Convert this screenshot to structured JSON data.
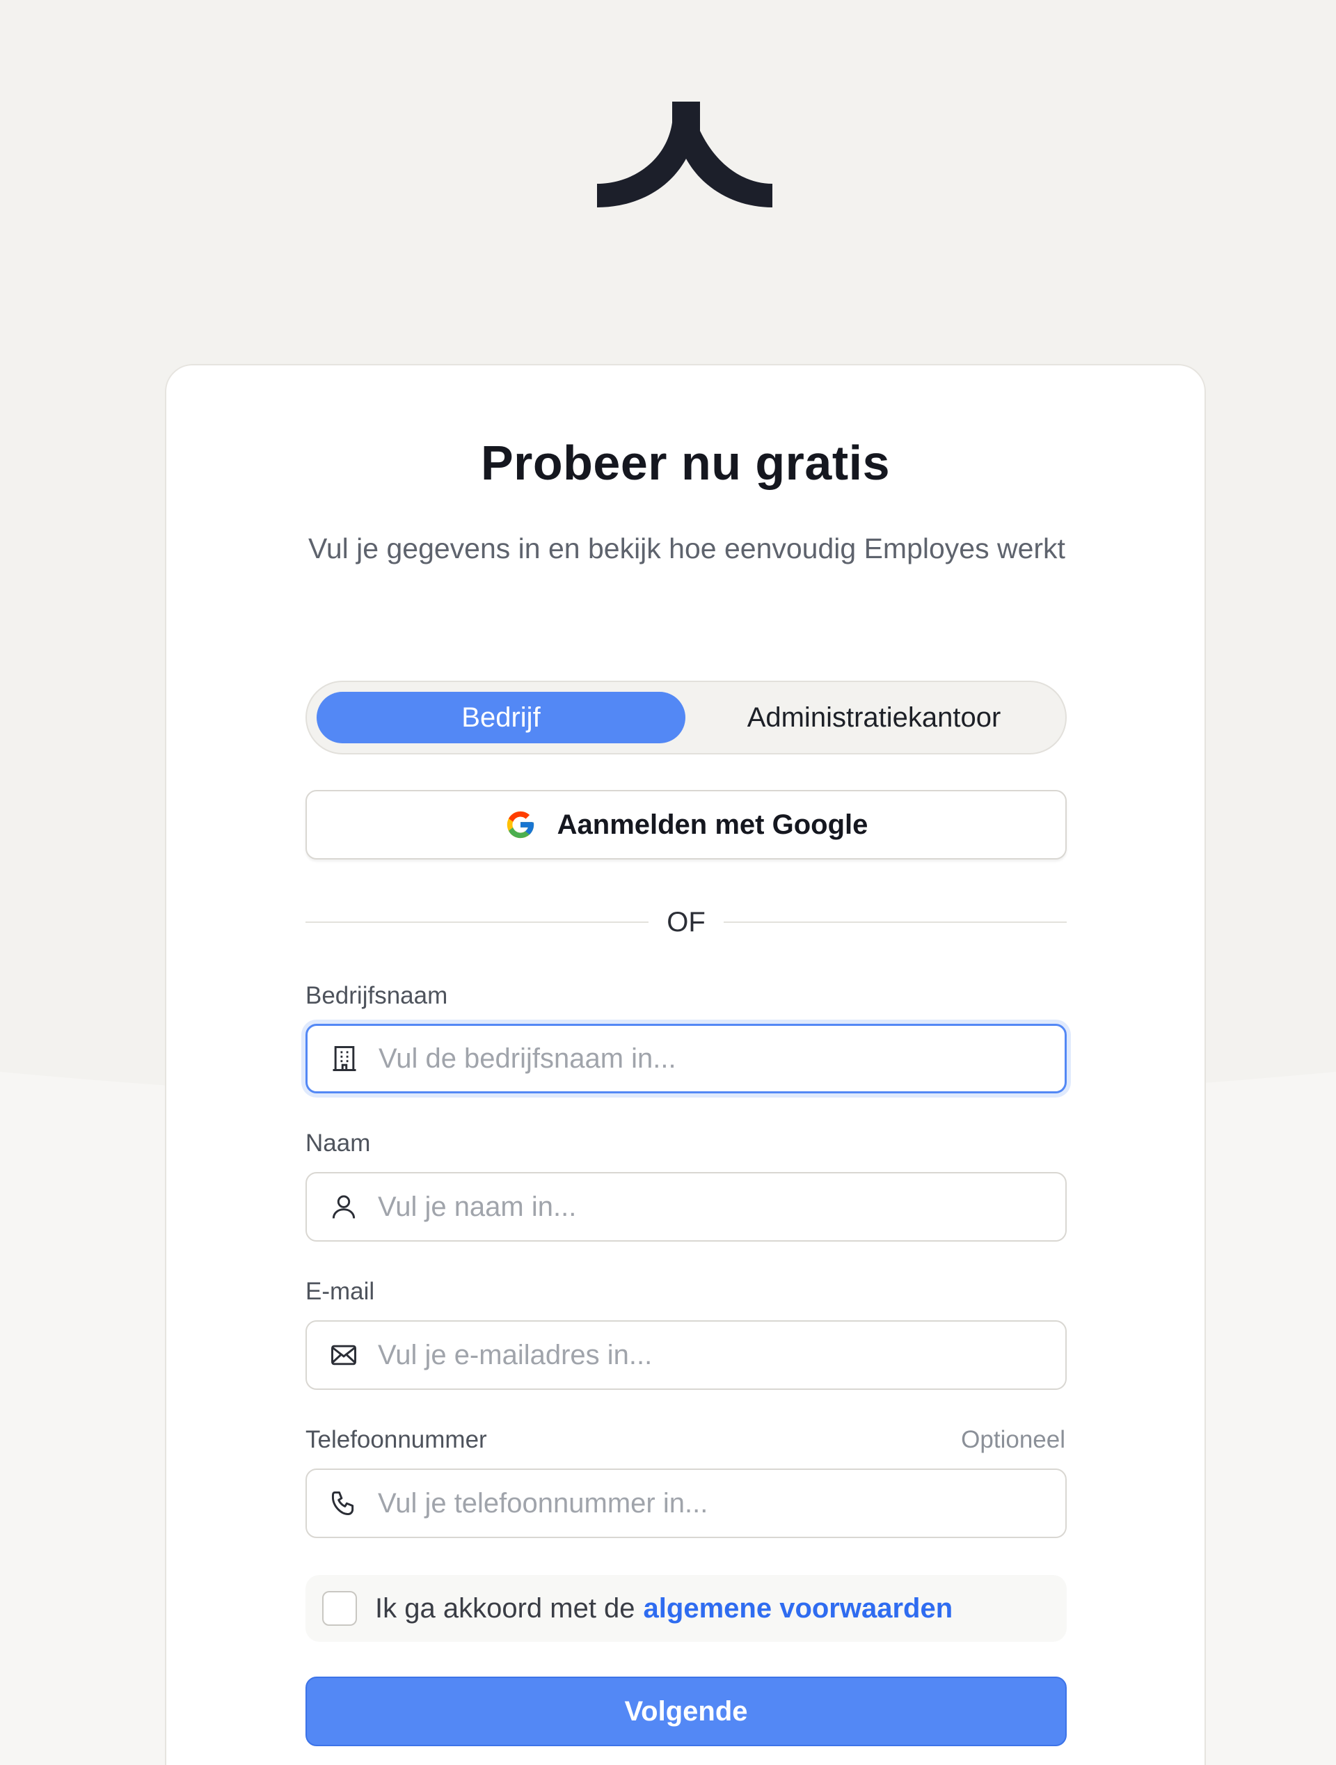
{
  "brand": {
    "accent": "#5388f5",
    "link": "#2f6cf0",
    "logo_color": "#1c1f2a",
    "logo_icon": "employes-logo-icon"
  },
  "header": {
    "title": "Probeer nu gratis",
    "subtitle": "Vul je gegevens in en bekijk hoe eenvoudig Employes werkt"
  },
  "account_type": {
    "options": [
      "Bedrijf",
      "Administratiekantoor"
    ],
    "selected": "Bedrijf"
  },
  "google": {
    "label": "Aanmelden met Google",
    "icon": "google-icon"
  },
  "divider": {
    "label": "OF"
  },
  "fields": {
    "company": {
      "label": "Bedrijfsnaam",
      "placeholder": "Vul de bedrijfsnaam in...",
      "value": "",
      "icon": "building-icon"
    },
    "name": {
      "label": "Naam",
      "placeholder": "Vul je naam in...",
      "value": "",
      "icon": "user-icon"
    },
    "email": {
      "label": "E-mail",
      "placeholder": "Vul je e-mailadres in...",
      "value": "",
      "icon": "mail-icon"
    },
    "phone": {
      "label": "Telefoonnummer",
      "hint": "Optioneel",
      "placeholder": "Vul je telefoonnummer in...",
      "value": "",
      "icon": "phone-icon"
    }
  },
  "terms": {
    "text": "Ik ga akkoord met de",
    "link": "algemene voorwaarden",
    "checked": false
  },
  "submit": {
    "label": "Volgende"
  }
}
